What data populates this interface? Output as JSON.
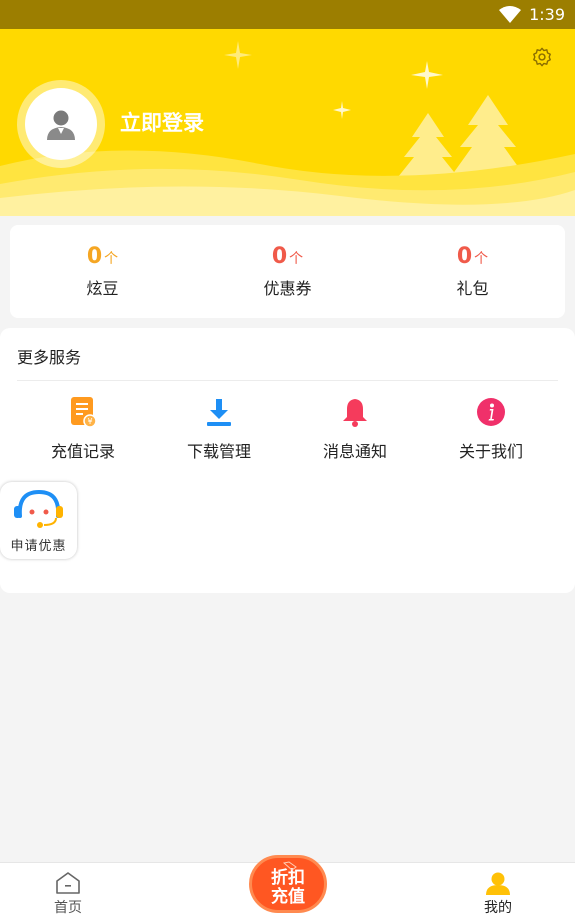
{
  "status_bar": {
    "time": "1:39"
  },
  "header": {
    "login_text": "立即登录"
  },
  "stats": [
    {
      "value": "0",
      "unit": "个",
      "label": "炫豆",
      "color": "#f5a623"
    },
    {
      "value": "0",
      "unit": "个",
      "label": "优惠券",
      "color": "#f05a4a"
    },
    {
      "value": "0",
      "unit": "个",
      "label": "礼包",
      "color": "#f05a4a"
    }
  ],
  "services": {
    "title": "更多服务",
    "items": [
      {
        "label": "充值记录",
        "icon": "recharge-record-icon"
      },
      {
        "label": "下载管理",
        "icon": "download-icon"
      },
      {
        "label": "消息通知",
        "icon": "bell-icon"
      },
      {
        "label": "关于我们",
        "icon": "info-icon"
      }
    ],
    "promo_label": "申请优惠"
  },
  "bottom_nav": {
    "home_label": "首页",
    "fab_line1": "折扣",
    "fab_line2": "充值",
    "mine_label": "我的"
  },
  "colors": {
    "header_bg": "#ffd900",
    "accent_orange": "#ff5722",
    "status_bar": "#9c7e00"
  }
}
